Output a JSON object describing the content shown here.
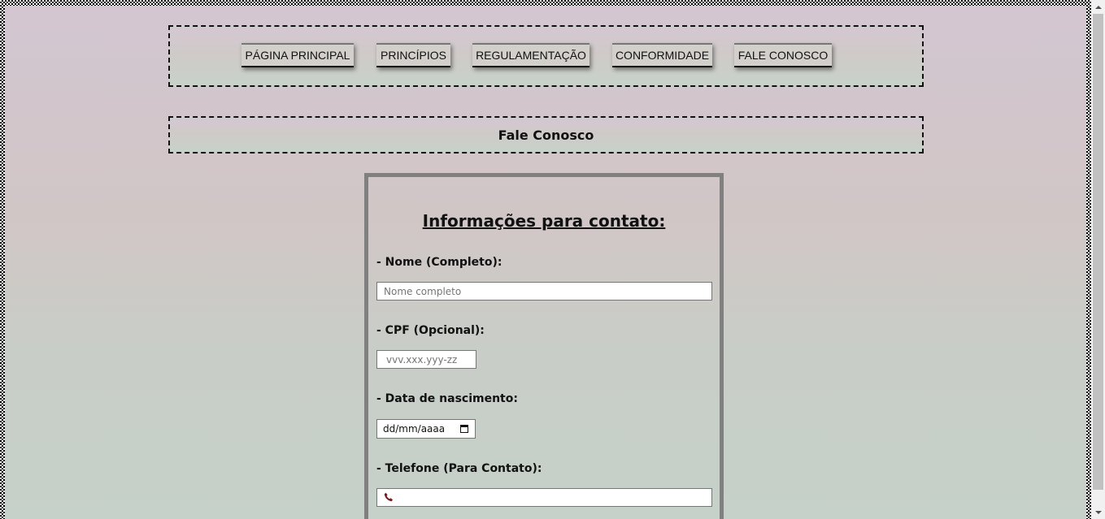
{
  "nav": {
    "items": [
      {
        "label": "PÁGINA PRINCIPAL"
      },
      {
        "label": "PRINCÍPIOS"
      },
      {
        "label": "REGULAMENTAÇÃO"
      },
      {
        "label": "CONFORMIDADE"
      },
      {
        "label": "FALE CONOSCO"
      }
    ]
  },
  "page": {
    "title": "Fale Conosco"
  },
  "form": {
    "heading": "Informações para contato:",
    "name": {
      "label": "- Nome (Completo):",
      "placeholder": "Nome completo",
      "value": ""
    },
    "cpf": {
      "label": "- CPF (Opcional):",
      "placeholder": "vvv.xxx.yyy-zz",
      "value": ""
    },
    "birth": {
      "label": "- Data de nascimento:",
      "display": "dd/mm/aaaa",
      "icon": "calendar-icon"
    },
    "phone": {
      "label": "- Telefone (Para Contato):",
      "value": "",
      "icon": "phone-icon"
    }
  },
  "colors": {
    "background_top": "#d3c6d2",
    "background_bottom": "#c6d1c9",
    "form_border": "#808080",
    "nav_button": "#d3d0cb"
  }
}
